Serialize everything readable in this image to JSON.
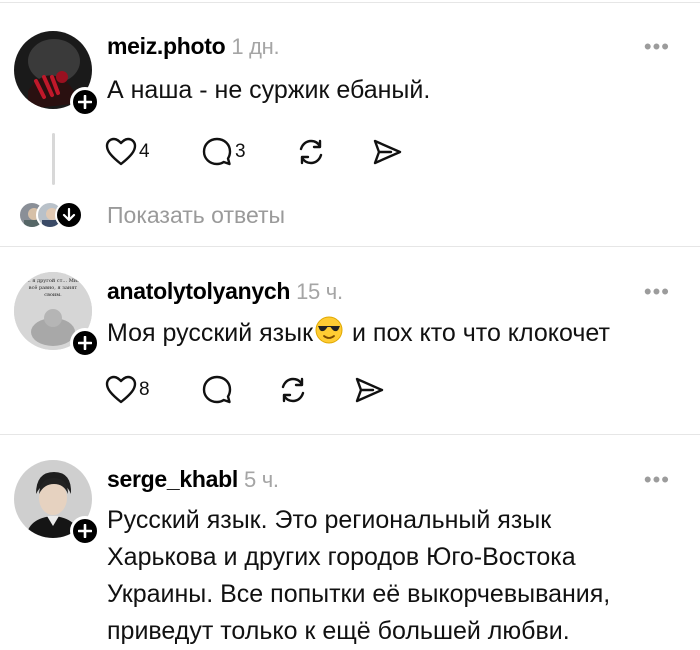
{
  "colors": {
    "text": "#111111",
    "muted": "#a5a5a5",
    "separator": "#e6e6e6",
    "follow_badge": "#000000"
  },
  "posts": [
    {
      "username": "meiz.photo",
      "time": "1 дн.",
      "more": "•••",
      "lines": [
        "А наша - не суржик ебаный."
      ],
      "likes": "4",
      "comments": "3",
      "show_replies": "Показать ответы"
    },
    {
      "username": "anatolytolyanych",
      "time": "15 ч.",
      "more": "•••",
      "text_before_emoji": "Моя русский язык",
      "emoji": "smiling-face-with-sunglasses",
      "text_after_emoji": " и пох кто что клокочет",
      "avatar_text": "... я другой ст... Мне всё равно, я занят своим.",
      "likes": "8"
    },
    {
      "username": "serge_khabl",
      "time": "5 ч.",
      "more": "•••",
      "lines": [
        "Русский язык. Это региональный язык",
        "Харькова и других городов Юго-Востока",
        "Украины. Все попытки её выкорчевывания,",
        "приведут только к ещё большей любви."
      ]
    }
  ]
}
